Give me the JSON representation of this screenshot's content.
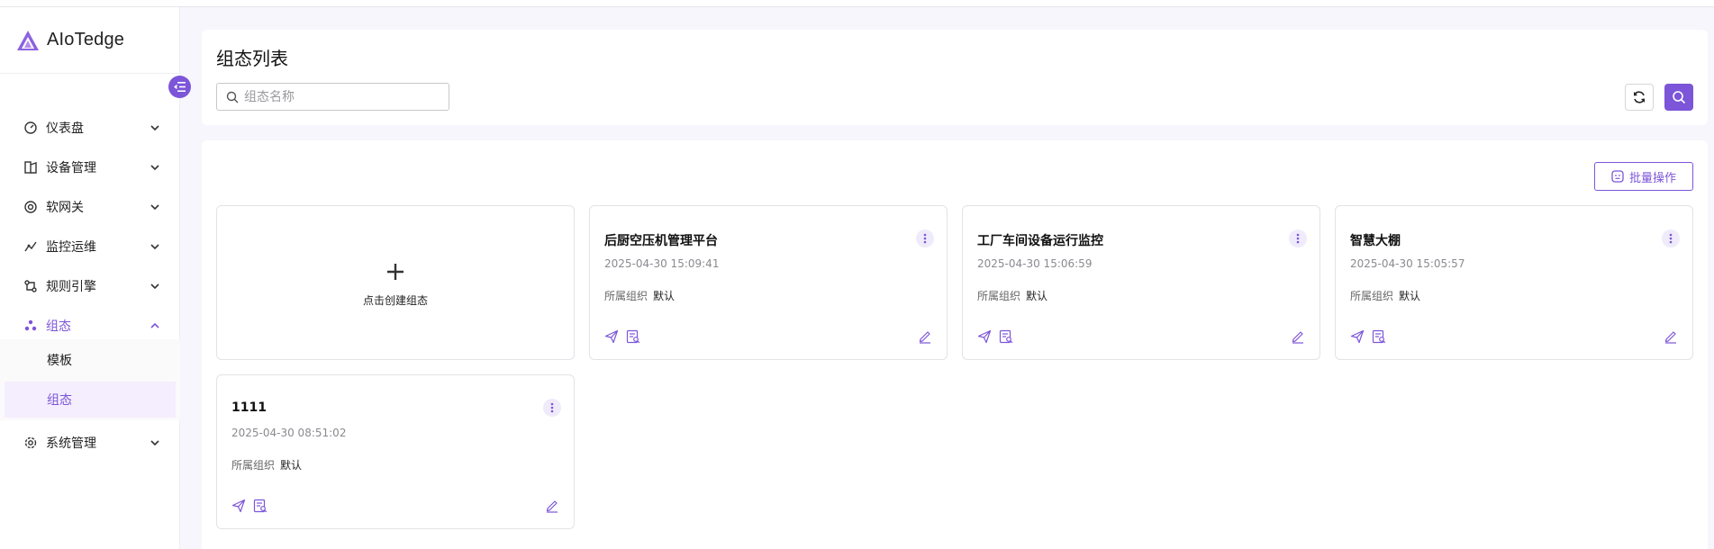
{
  "app": {
    "name": "AIoTedge"
  },
  "colors": {
    "accent": "#7c55d9",
    "accent_light": "#f5eefe"
  },
  "sidebar": {
    "items": [
      {
        "label": "仪表盘",
        "icon": "dashboard-gauge-icon"
      },
      {
        "label": "设备管理",
        "icon": "device-icon"
      },
      {
        "label": "软网关",
        "icon": "gateway-icon"
      },
      {
        "label": "监控运维",
        "icon": "monitor-icon"
      },
      {
        "label": "规则引擎",
        "icon": "rule-engine-icon"
      },
      {
        "label": "组态",
        "icon": "configuration-icon",
        "expanded": true
      },
      {
        "label": "系统管理",
        "icon": "settings-gear-icon"
      }
    ],
    "submenu": [
      {
        "label": "模板"
      },
      {
        "label": "组态",
        "selected": true
      }
    ]
  },
  "header": {
    "title": "组态列表",
    "search": {
      "placeholder": "组态名称",
      "value": ""
    }
  },
  "toolbar": {
    "batch_label": "批量操作"
  },
  "create_card": {
    "label": "点击创建组态"
  },
  "cards": [
    {
      "title": "后厨空压机管理平台",
      "time": "2025-04-30 15:09:41",
      "org_label": "所属组织",
      "org_value": "默认"
    },
    {
      "title": "工厂车间设备运行监控",
      "time": "2025-04-30 15:06:59",
      "org_label": "所属组织",
      "org_value": "默认"
    },
    {
      "title": "智慧大棚",
      "time": "2025-04-30 15:05:57",
      "org_label": "所属组织",
      "org_value": "默认"
    },
    {
      "title": "1111",
      "time": "2025-04-30 08:51:02",
      "org_label": "所属组织",
      "org_value": "默认"
    }
  ]
}
